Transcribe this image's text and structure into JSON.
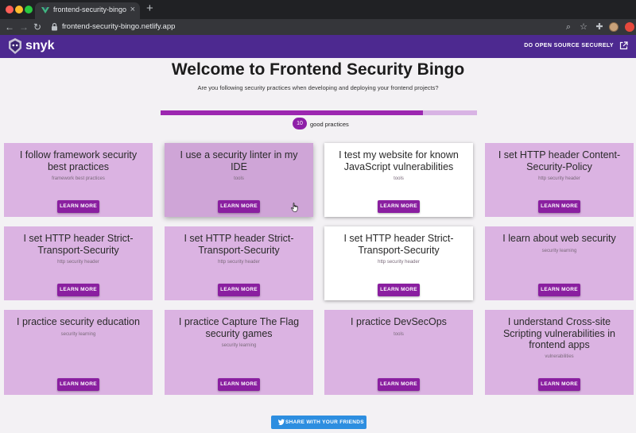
{
  "browser": {
    "tab_title": "frontend-security-bingo",
    "url": "frontend-security-bingo.netlify.app",
    "icons": [
      "close-icon",
      "plus-icon",
      "back-icon",
      "forward-icon",
      "reload-icon",
      "lock-icon",
      "search-icon",
      "star-icon",
      "puzzle-icon"
    ]
  },
  "site": {
    "logo_text": "snyk",
    "header_link": "DO OPEN SOURCE SECURELY",
    "title": "Welcome to Frontend Security Bingo",
    "subtitle": "Are you following security practices when developing and deploying your frontend projects?",
    "progress_value": 0.83,
    "practices_count": "10",
    "practices_label": "good practices",
    "share_label": "SHARE WITH YOUR FRIENDS",
    "colors": {
      "brand": "#4d2990",
      "accent": "#8a1fa0",
      "card": "#dbb3e2",
      "share": "#2d8ee0"
    }
  },
  "cards": [
    {
      "title": "I follow framework security best practices",
      "tag": "framework best practices",
      "button": "LEARN MORE",
      "state": "checked"
    },
    {
      "title": "I use a security linter in my IDE",
      "tag": "tools",
      "button": "LEARN MORE",
      "state": "hover"
    },
    {
      "title": "I test my website for known JavaScript vulnerabilities",
      "tag": "tools",
      "button": "LEARN MORE",
      "state": "unchecked"
    },
    {
      "title": "I set HTTP header Content-Security-Policy",
      "tag": "http security header",
      "button": "LEARN MORE",
      "state": "checked"
    },
    {
      "title": "I set HTTP header Strict-Transport-Security",
      "tag": "http security header",
      "button": "LEARN MORE",
      "state": "checked"
    },
    {
      "title": "I set HTTP header Strict-Transport-Security",
      "tag": "http security header",
      "button": "LEARN MORE",
      "state": "checked"
    },
    {
      "title": "I set HTTP header Strict-Transport-Security",
      "tag": "http security header",
      "button": "LEARN MORE",
      "state": "unchecked"
    },
    {
      "title": "I learn about web security",
      "tag": "security learning",
      "button": "LEARN MORE",
      "state": "checked"
    },
    {
      "title": "I practice security education",
      "tag": "security learning",
      "button": "LEARN MORE",
      "state": "checked"
    },
    {
      "title": "I practice Capture The Flag security games",
      "tag": "security learning",
      "button": "LEARN MORE",
      "state": "checked"
    },
    {
      "title": "I practice DevSecOps",
      "tag": "tools",
      "button": "LEARN MORE",
      "state": "checked"
    },
    {
      "title": "I understand Cross-site Scripting vulnerabilities in frontend apps",
      "tag": "vulnerabilities",
      "button": "LEARN MORE",
      "state": "checked"
    }
  ]
}
